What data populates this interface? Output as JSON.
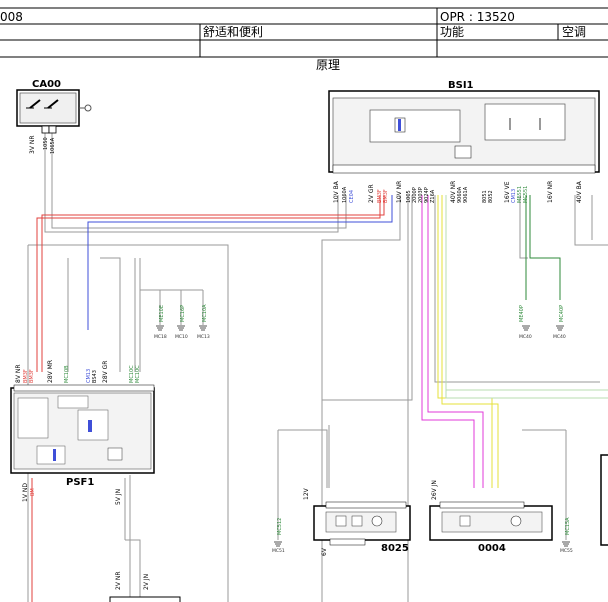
{
  "header": {
    "code": "008",
    "opr": "OPR : 13520",
    "category": "舒适和便利",
    "function_label": "功能",
    "function_value": "空调",
    "section": "原理"
  },
  "components": {
    "ca00": "CA00",
    "bsi1": "BSI1",
    "psf1": "PSF1",
    "c8025": "8025",
    "c0004": "0004"
  },
  "connectors": {
    "ca00_conn": "3V NR",
    "bsi_conn_1": "10V BA",
    "bsi_conn_2": "2V GR",
    "bsi_conn_3": "10V NR",
    "bsi_conn_4": "40V NR",
    "bsi_conn_5": "16V VE",
    "bsi_conn_6": "16V NR",
    "bsi_conn_7": "40V BA",
    "psf_conn_1": "8V NR",
    "psf_conn_2": "28V MR",
    "psf_conn_3": "28V GR",
    "psf_conn_4": "1V ND",
    "psf_conn_5": "5V JN",
    "c8025_conn_1": "12V",
    "c8025_conn_2": "6V",
    "c0004_conn": "26V JN",
    "bottom_conn_1": "2V NR",
    "bottom_conn_2": "2V JN"
  },
  "wires": {
    "ca_w1": "1050",
    "ca_w2": "1065A",
    "bsi_w_1060a": "1060A",
    "bsi_w_cd4": "CE04",
    "bsi_w_bm3f_a": "BM3F",
    "bsi_w_bm3f_b": "BM3F",
    "bsi_w_1005": "1005",
    "bsi_w_2000p": "2000P",
    "bsi_w_2003p": "2003P",
    "bsi_w_9024p": "9024P",
    "bsi_w_z16a": "Z16A",
    "bsi_w_9060a": "9060A",
    "bsi_w_9061a": "9061A",
    "bsi_w_8051": "8051",
    "bsi_w_8052": "8052",
    "bsi_w_cm13": "CM13",
    "bsi_w_mes51": "MES51",
    "bsi_w_mc551": "MC551"
  },
  "ground_labels": {
    "me10e": "ME10E",
    "mc16e": "MC16P",
    "mc10a": "MC10A",
    "mc18": "MC18",
    "mc10": "MC10",
    "mc13": "MC13",
    "me40p": "ME40P",
    "mc40": "MC40",
    "mc40p": "MC40P",
    "mc40b": "MC40",
    "mc51": "MC51",
    "mc512": "MC512",
    "mc55": "MC55",
    "mc15a": "MC15A"
  },
  "psf_labels": {
    "bm3f_a": "BM3F",
    "bm3f_b": "BM3F",
    "mc10b": "MC10B",
    "cm13": "CM13",
    "bs43": "BS43",
    "mc10c": "MC10C",
    "mc10d": "MC10C",
    "bm": "BM"
  },
  "colors": {
    "red": "#e0403c",
    "blue": "#3f4fd8",
    "green": "#2e8a3a",
    "magenta": "#e23ad9",
    "yellow": "#e6e03a",
    "pale_green": "#b9ddb0",
    "grey_wire": "#9a9a9a"
  }
}
